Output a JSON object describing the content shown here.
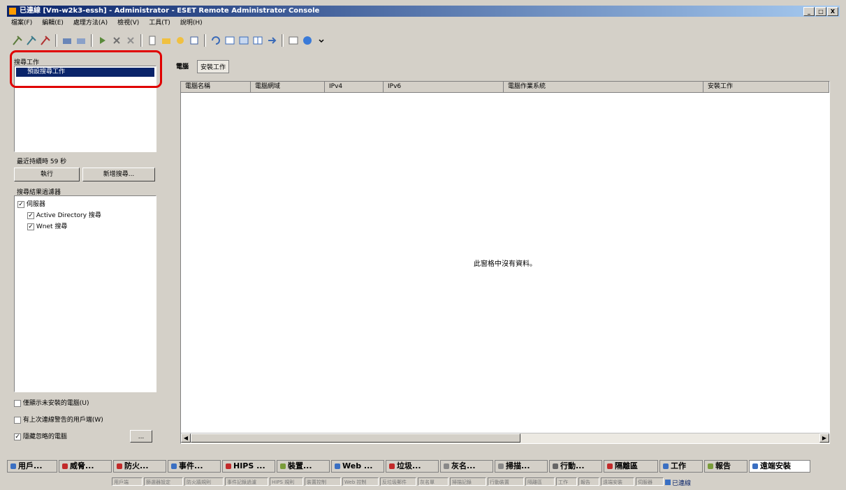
{
  "window": {
    "title": "已連線 [Vm-w2k3-essh] - Administrator - ESET Remote Administrator Console",
    "min": "_",
    "max": "□",
    "close": "X"
  },
  "menu": [
    "檔案(F)",
    "編輯(E)",
    "處理方法(A)",
    "檢視(V)",
    "工具(T)",
    "說明(H)"
  ],
  "left": {
    "tasks_label": "搜尋工作",
    "task_item": "預設搜尋工作",
    "last_run": "最近持續時 59 秒",
    "run_button": "執行",
    "new_search_button": "新增搜尋...",
    "filter_label": "搜尋結果過濾器",
    "tree": {
      "root": "伺服器",
      "ad": "Active Directory 搜尋",
      "wnet": "Wnet 搜尋"
    },
    "chk1": "僅顯示未安裝的電腦(U)",
    "chk2": "有上次連線警告的用戶端(W)",
    "chk3": "隱藏忽略的電腦",
    "more": "..."
  },
  "right": {
    "tabs": [
      "電腦",
      "安裝工作"
    ],
    "columns": [
      "電腦名稱",
      "電腦網域",
      "IPv4",
      "IPv6",
      "電腦作業系統",
      "安裝工作"
    ],
    "empty_text": "此窗格中沒有資料。",
    "scroll_left": "◀",
    "scroll_right": "▶"
  },
  "views": [
    {
      "label": "用戶...",
      "color": "#3a6fc2"
    },
    {
      "label": "威脅...",
      "color": "#c22a2a"
    },
    {
      "label": "防火...",
      "color": "#c22a2a"
    },
    {
      "label": "事件...",
      "color": "#3a6fc2"
    },
    {
      "label": "HIPS ...",
      "color": "#c22a2a"
    },
    {
      "label": "裝置...",
      "color": "#7a9c3a"
    },
    {
      "label": "Web ...",
      "color": "#3a6fc2"
    },
    {
      "label": "垃圾...",
      "color": "#c22a2a"
    },
    {
      "label": "灰名...",
      "color": "#888888"
    },
    {
      "label": "掃描...",
      "color": "#888888"
    },
    {
      "label": "行動...",
      "color": "#666666"
    },
    {
      "label": "隔離區",
      "color": "#c22a2a"
    },
    {
      "label": "工作",
      "color": "#3a6fc2"
    },
    {
      "label": "報告",
      "color": "#7a9c3a"
    },
    {
      "label": "遠端安裝",
      "color": "#3a6fc2"
    }
  ],
  "status": [
    "用戶端",
    "篩選器設定",
    "防火牆規則",
    "事件記錄過濾",
    "HIPS 規則",
    "裝置控制",
    "Web 控制",
    "反垃圾郵件",
    "灰名單",
    "掃描記錄",
    "行動裝置",
    "隔離區",
    "工作",
    "報告",
    "遠端安裝",
    "伺服器"
  ],
  "connected": "已連線"
}
